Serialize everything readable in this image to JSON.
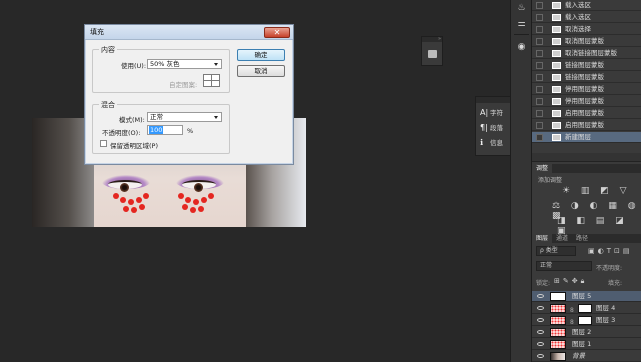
{
  "dialog": {
    "title": "填充",
    "close_glyph": "✕",
    "contents_group": "内容",
    "use_label": "使用(U):",
    "use_value": "50% 灰色",
    "custom_pattern_label": "自定图案:",
    "blending_group": "混合",
    "mode_label": "模式(M):",
    "mode_value": "正常",
    "opacity_label": "不透明度(O):",
    "opacity_value": "100",
    "opacity_unit": "%",
    "preserve_label": "保留透明区域(P)",
    "ok_label": "确定",
    "cancel_label": "取消"
  },
  "floating_panel": {
    "items": [
      {
        "icon": "A|",
        "label": "字符"
      },
      {
        "icon": "¶|",
        "label": "段落"
      },
      {
        "icon": "ℹ",
        "label": "信息"
      }
    ]
  },
  "history": {
    "items": [
      {
        "label": "载入选区",
        "selected": false
      },
      {
        "label": "载入选区",
        "selected": false
      },
      {
        "label": "取消选择",
        "selected": false
      },
      {
        "label": "取消图层蒙版",
        "selected": false
      },
      {
        "label": "取消链接图层蒙版",
        "selected": false
      },
      {
        "label": "链接图层蒙版",
        "selected": false
      },
      {
        "label": "链接图层蒙版",
        "selected": false
      },
      {
        "label": "停用图层蒙版",
        "selected": false
      },
      {
        "label": "停用图层蒙版",
        "selected": false
      },
      {
        "label": "启用图层蒙版",
        "selected": false
      },
      {
        "label": "启用图层蒙版",
        "selected": false
      },
      {
        "label": "新建图层",
        "selected": true
      }
    ]
  },
  "adjustments": {
    "tab": "调整",
    "subtitle": "添加调整",
    "row1": "☀ ▥ ◩ ▽",
    "row2": "⚖ ◑ ◐ ▦ ◍ ▩",
    "row3": "◨ ◧ ▤ ◪ ▣"
  },
  "layers": {
    "tabs": [
      "图层",
      "通道",
      "路径"
    ],
    "filter_label": "ρ 类型",
    "blend_mode": "正常",
    "opacity_label": "不透明度:",
    "lock_label": "锁定:",
    "fill_label": "填充:",
    "items": [
      {
        "name": "图层 5",
        "selected": true
      },
      {
        "name": "图层 4",
        "selected": false
      },
      {
        "name": "图层 3",
        "selected": false
      },
      {
        "name": "图层 2",
        "selected": false
      },
      {
        "name": "图层 1",
        "selected": false
      },
      {
        "name": "背景",
        "selected": false
      }
    ]
  }
}
